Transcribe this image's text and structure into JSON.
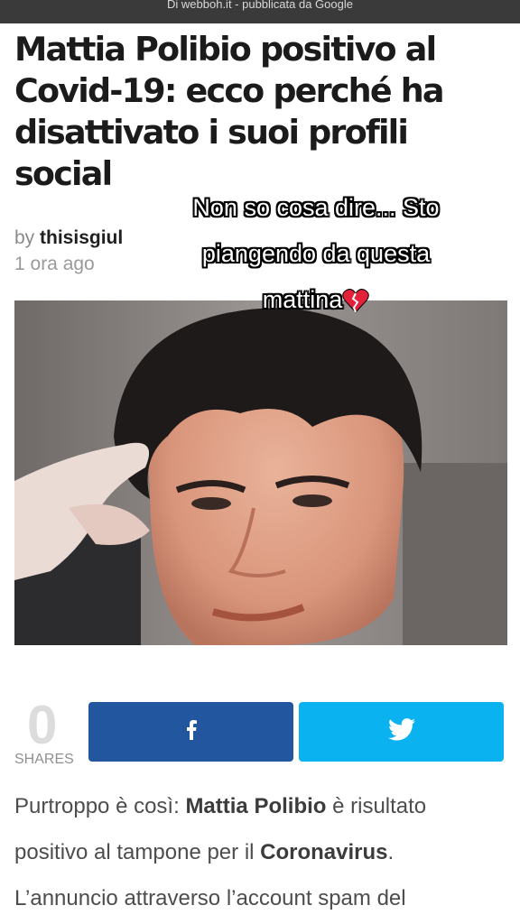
{
  "top_bar": {
    "text": "Di webboh.it - pubblicata da Google"
  },
  "article": {
    "headline": "Mattia Polibio positivo al Covid-19: ecco perché ha disattivato i suoi profili social",
    "byline_prefix": "by",
    "author": "thisisgiul",
    "time_ago": "1 ora ago"
  },
  "overlay_caption": {
    "line1": "Non so cosa dire... Sto",
    "line2": "piangendo da questa",
    "line3": "mattina",
    "emoji_icon": "broken-heart-icon"
  },
  "share": {
    "count": "0",
    "label": "SHARES",
    "facebook_icon": "facebook-icon",
    "twitter_icon": "twitter-icon",
    "facebook_color": "#22579f",
    "twitter_color": "#0ab2ef"
  },
  "body": {
    "p1": "Purtroppo è così: ",
    "p1_bold": "Mattia Polibio",
    "p2": " è risultato",
    "p3": "positivo al tampone per il ",
    "p3_bold": "Coronavirus",
    "p4": ".",
    "p5": "L’annuncio attraverso l’account spam del"
  }
}
